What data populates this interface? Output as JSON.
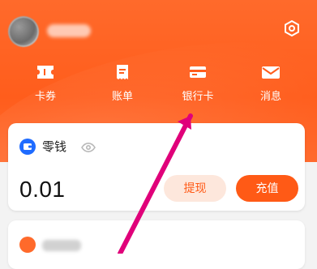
{
  "header": {
    "settings_icon": "settings-hexagon-icon"
  },
  "quick_actions": [
    {
      "label": "卡券",
      "icon": "ticket-icon"
    },
    {
      "label": "账单",
      "icon": "bill-icon"
    },
    {
      "label": "银行卡",
      "icon": "bank-card-icon"
    },
    {
      "label": "消息",
      "icon": "mail-icon"
    }
  ],
  "balance_card": {
    "title": "零钱",
    "amount": "0.01",
    "withdraw_label": "提现",
    "topup_label": "充值"
  },
  "colors": {
    "brand_orange": "#ff5a16",
    "withdraw_bg": "#fde7dc",
    "annotation_arrow": "#e0007a"
  }
}
